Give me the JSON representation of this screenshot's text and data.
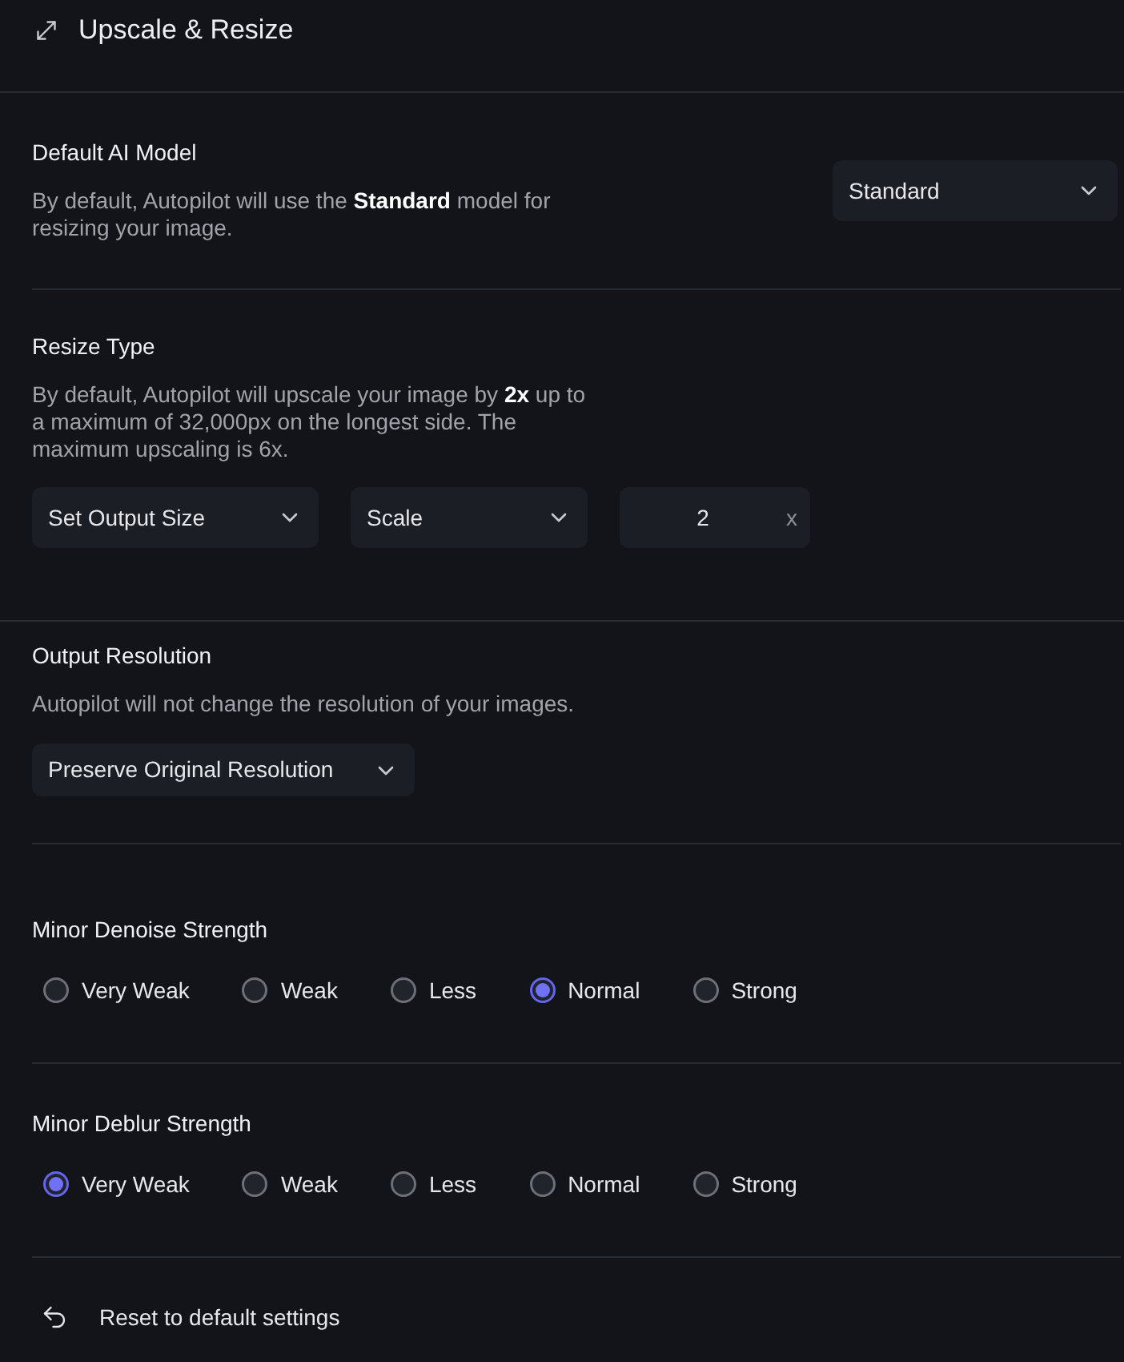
{
  "header": {
    "title": "Upscale & Resize"
  },
  "sections": [
    {
      "kind": "model",
      "title": "Default AI Model",
      "description": "By default, Autopilot will use the **Standard** model for resizing your image.",
      "controls": [
        {
          "kind": "dropdown",
          "value": "Standard"
        }
      ]
    },
    {
      "kind": "resize",
      "title": "Resize Type",
      "description": "By default, Autopilot will upscale your image by **2x** up to a maximum of 32,000px on the longest side. The maximum upscaling is 6x.",
      "controls": [
        {
          "kind": "dropdown",
          "value": "Set Output Size"
        },
        {
          "kind": "dropdown",
          "value": "Scale"
        },
        {
          "kind": "number",
          "value": "2",
          "unit": "x"
        }
      ]
    },
    {
      "kind": "resolution",
      "title": "Output Resolution",
      "description": "Autopilot will not change the resolution of your images.",
      "controls": [
        {
          "kind": "dropdown",
          "value": "Preserve Original Resolution"
        }
      ]
    },
    {
      "kind": "radio",
      "title": "Minor Denoise Strength",
      "options": [
        {
          "label": "Very Weak",
          "selected": false
        },
        {
          "label": "Weak",
          "selected": false
        },
        {
          "label": "Less",
          "selected": false
        },
        {
          "label": "Normal",
          "selected": true
        },
        {
          "label": "Strong",
          "selected": false
        }
      ]
    },
    {
      "kind": "radio",
      "title": "Minor Deblur Strength",
      "options": [
        {
          "label": "Very Weak",
          "selected": true
        },
        {
          "label": "Weak",
          "selected": false
        },
        {
          "label": "Less",
          "selected": false
        },
        {
          "label": "Normal",
          "selected": false
        },
        {
          "label": "Strong",
          "selected": false
        }
      ]
    }
  ],
  "reset": {
    "label": "Reset to default settings"
  }
}
